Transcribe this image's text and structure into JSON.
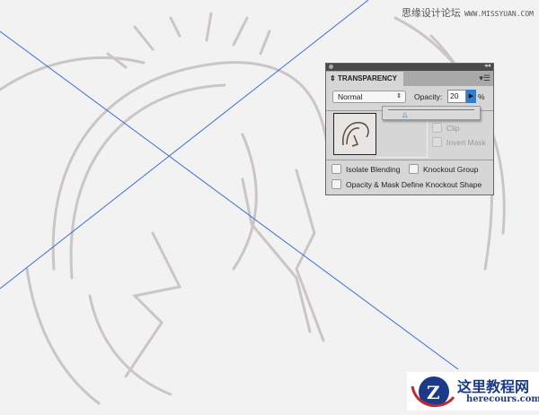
{
  "panel": {
    "title": "TRANSPARENCY",
    "blend_mode": "Normal",
    "opacity_label": "Opacity:",
    "opacity_value": "20",
    "percent": "%",
    "opacity_slider_fraction": 0.2,
    "clip": "Clip",
    "invert_mask": "Invert Mask",
    "isolate_blending": "Isolate Blending",
    "knockout_group": "Knockout Group",
    "opacity_mask_knockout": "Opacity & Mask Define Knockout Shape"
  },
  "watermarks": {
    "top_cn": "思缘设计论坛",
    "top_url": "WWW.MISSYUAN.COM",
    "bottom_cn": "这里教程网",
    "bottom_url": "herecours.com"
  },
  "colors": {
    "guide": "#3b6fd8",
    "sketch": "#c8c2c4",
    "accent": "#2f7fd0"
  }
}
